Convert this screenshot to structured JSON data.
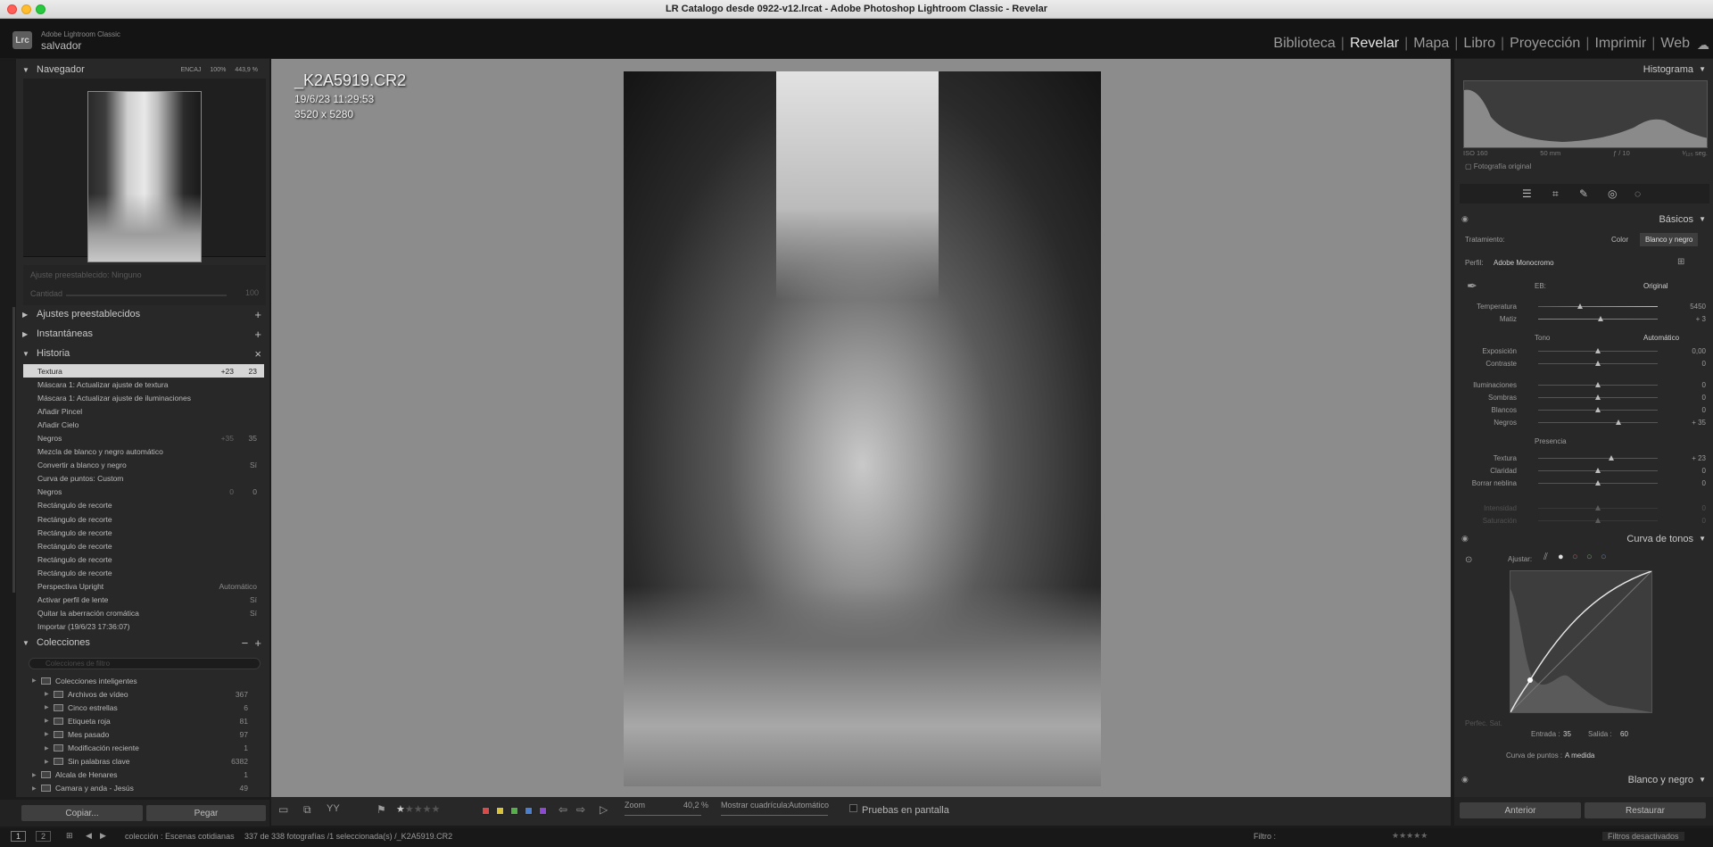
{
  "window": {
    "title": "LR Catalogo desde 0922-v12.lrcat - Adobe Photoshop Lightroom Classic - Revelar"
  },
  "identity": {
    "logo": "Lrc",
    "app": "Adobe Lightroom Classic",
    "user": "salvador"
  },
  "modules": [
    "Biblioteca",
    "Revelar",
    "Mapa",
    "Libro",
    "Proyección",
    "Imprimir",
    "Web"
  ],
  "active_module": "Revelar",
  "left": {
    "navigator": {
      "title": "Navegador",
      "fit": "ENCAJ",
      "zoom1": "100%",
      "zoom2": "443,9 %"
    },
    "ajuste": {
      "label": "Ajuste preestablecido: Ninguno",
      "cantidad": "Cantidad",
      "value": "100"
    },
    "presets": "Ajustes preestablecidos",
    "snapshots": "Instantáneas",
    "history": {
      "title": "Historia",
      "items": [
        {
          "label": "Textura",
          "v1": "+23",
          "v2": "23"
        },
        {
          "label": "Máscara 1: Actualizar ajuste de textura",
          "v1": "",
          "v2": ""
        },
        {
          "label": "Máscara 1: Actualizar ajuste de iluminaciones",
          "v1": "",
          "v2": ""
        },
        {
          "label": "Añadir Pincel",
          "v1": "",
          "v2": ""
        },
        {
          "label": "Añadir Cielo",
          "v1": "",
          "v2": ""
        },
        {
          "label": "Negros",
          "v1": "+35",
          "v2": "35"
        },
        {
          "label": "Mezcla de blanco y negro automático",
          "v1": "",
          "v2": ""
        },
        {
          "label": "Convertir a blanco y negro",
          "v1": "",
          "v2": "Sí"
        },
        {
          "label": "Curva de puntos: Custom",
          "v1": "",
          "v2": ""
        },
        {
          "label": "Negros",
          "v1": "0",
          "v2": "0"
        },
        {
          "label": "Rectángulo de recorte",
          "v1": "",
          "v2": ""
        },
        {
          "label": "Rectángulo de recorte",
          "v1": "",
          "v2": ""
        },
        {
          "label": "Rectángulo de recorte",
          "v1": "",
          "v2": ""
        },
        {
          "label": "Rectángulo de recorte",
          "v1": "",
          "v2": ""
        },
        {
          "label": "Rectángulo de recorte",
          "v1": "",
          "v2": ""
        },
        {
          "label": "Rectángulo de recorte",
          "v1": "",
          "v2": ""
        },
        {
          "label": "Perspectiva Upright",
          "v1": "",
          "v2": "Automático"
        },
        {
          "label": "Activar perfil de lente",
          "v1": "",
          "v2": "Sí"
        },
        {
          "label": "Quitar la aberración cromática",
          "v1": "",
          "v2": "Sí"
        },
        {
          "label": "Importar (19/6/23 17:36:07)",
          "v1": "",
          "v2": ""
        }
      ]
    },
    "collections": {
      "title": "Colecciones",
      "search": "Colecciones de filtro",
      "items": [
        {
          "label": "Colecciones inteligentes",
          "count": "",
          "indent": 1
        },
        {
          "label": "Archivos de vídeo",
          "count": "367",
          "indent": 2
        },
        {
          "label": "Cinco estrellas",
          "count": "6",
          "indent": 2
        },
        {
          "label": "Etiqueta roja",
          "count": "81",
          "indent": 2
        },
        {
          "label": "Mes pasado",
          "count": "97",
          "indent": 2
        },
        {
          "label": "Modificación reciente",
          "count": "1",
          "indent": 2
        },
        {
          "label": "Sin palabras clave",
          "count": "6382",
          "indent": 2
        },
        {
          "label": "Alcala de Henares",
          "count": "1",
          "indent": 1
        },
        {
          "label": "Camara y anda - Jesús",
          "count": "49",
          "indent": 1
        }
      ]
    },
    "copy": "Copiar...",
    "paste": "Pegar"
  },
  "photo": {
    "filename": "_K2A5919.CR2",
    "date": "19/6/23 11:29:53",
    "size": "3520 x 5280"
  },
  "toolbar": {
    "zoom_label": "Zoom",
    "zoom_value": "40,2 %",
    "grid_label": "Mostrar cuadrícula:",
    "grid_value": "Automático",
    "proof": "Pruebas en pantalla",
    "swatch_colors": [
      "#d94b4b",
      "#d8c23a",
      "#55b04a",
      "#4a7fd0",
      "#8c4ad0"
    ]
  },
  "right": {
    "histogram": {
      "title": "Histograma",
      "iso": "ISO 160",
      "focal": "50 mm",
      "aperture": "ƒ / 10",
      "shutter": "¹⁄₁₂₅ seg.",
      "original": "Fotografía original"
    },
    "basic": {
      "title": "Básicos",
      "treatment": "Tratamiento:",
      "color": "Color",
      "bw": "Blanco y negro",
      "profile_label": "Perfil:",
      "profile": "Adobe Monocromo",
      "wb": "EB:",
      "wb_value": "Original",
      "tone": "Tono",
      "auto": "Automático",
      "presence": "Presencia",
      "sliders": [
        {
          "name": "Temperatura",
          "value": "5450",
          "pos": 0.35
        },
        {
          "name": "Matiz",
          "value": "+ 3",
          "pos": 0.52
        },
        {
          "name": "Exposición",
          "value": "0,00",
          "pos": 0.5
        },
        {
          "name": "Contraste",
          "value": "0",
          "pos": 0.5
        },
        {
          "name": "Iluminaciones",
          "value": "0",
          "pos": 0.5
        },
        {
          "name": "Sombras",
          "value": "0",
          "pos": 0.5
        },
        {
          "name": "Blancos",
          "value": "0",
          "pos": 0.5
        },
        {
          "name": "Negros",
          "value": "+ 35",
          "pos": 0.67
        },
        {
          "name": "Textura",
          "value": "+ 23",
          "pos": 0.61
        },
        {
          "name": "Claridad",
          "value": "0",
          "pos": 0.5
        },
        {
          "name": "Borrar neblina",
          "value": "0",
          "pos": 0.5
        },
        {
          "name": "Intensidad",
          "value": "0",
          "pos": 0.5
        },
        {
          "name": "Saturación",
          "value": "0",
          "pos": 0.5
        }
      ]
    },
    "tonecurve": {
      "title": "Curva de tonos",
      "adjust": "Ajustar:",
      "refine": "Perfec. Sat.",
      "input_label": "Entrada :",
      "input": "35",
      "output_label": "Salida :",
      "output": "60",
      "point_curve_label": "Curva de puntos :",
      "point_curve": "A medida"
    },
    "bw_mix": "Blanco y negro",
    "previous": "Anterior",
    "reset": "Restaurar"
  },
  "filmstrip": {
    "path": "colección : Escenas cotidianas",
    "count": "337 de 338 fotografías /1 seleccionada(s) /_K2A5919.CR2",
    "filter": "Filtro :",
    "filters_off": "Filtros desactivados",
    "pages": [
      "1",
      "2"
    ]
  }
}
